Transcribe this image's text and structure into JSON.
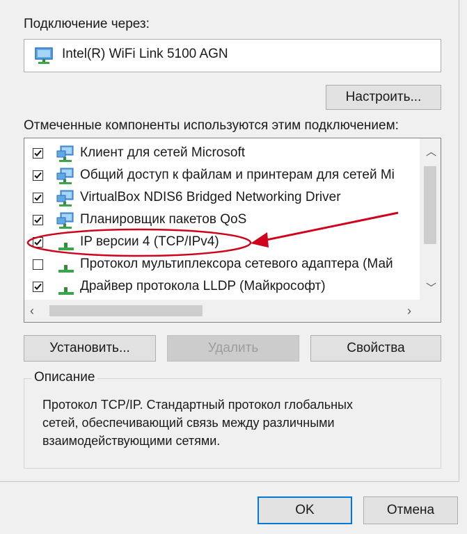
{
  "connect_via_label": "Подключение через:",
  "adapter": {
    "name": "Intel(R) WiFi Link 5100 AGN"
  },
  "configure_button": "Настроить...",
  "components_label": "Отмеченные компоненты используются этим подключением:",
  "components": [
    {
      "label": "Клиент для сетей Microsoft",
      "checked": true,
      "icon": "network-client-icon"
    },
    {
      "label": "Общий доступ к файлам и принтерам для сетей Mi",
      "checked": true,
      "icon": "network-client-icon"
    },
    {
      "label": "VirtualBox NDIS6 Bridged Networking Driver",
      "checked": true,
      "icon": "network-client-icon"
    },
    {
      "label": "Планировщик пакетов QoS",
      "checked": true,
      "icon": "network-client-icon"
    },
    {
      "label": "IP версии 4 (TCP/IPv4)",
      "checked": true,
      "icon": "protocol-icon"
    },
    {
      "label": "Протокол мультиплексора сетевого адаптера (Май",
      "checked": false,
      "icon": "protocol-icon"
    },
    {
      "label": "Драйвер протокола LLDP (Майкрософт)",
      "checked": true,
      "icon": "protocol-icon"
    }
  ],
  "buttons": {
    "install": "Установить...",
    "remove": "Удалить",
    "properties": "Свойства",
    "ok": "OK",
    "cancel": "Отмена"
  },
  "description": {
    "legend": "Описание",
    "text": "Протокол TCP/IP. Стандартный протокол глобальных\nсетей, обеспечивающий связь между различными\nвзаимодействующими сетями."
  },
  "annotation_color": "#d0021b"
}
